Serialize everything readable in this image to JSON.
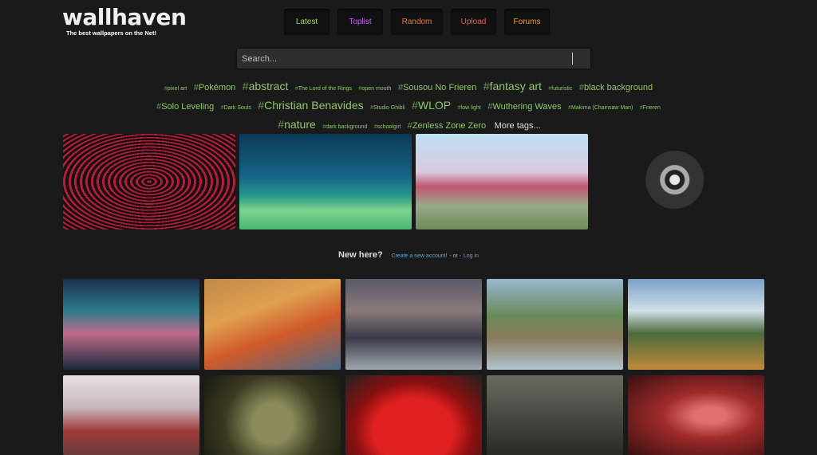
{
  "logo": {
    "title": "wallhaven",
    "tagline": "The best wallpapers on the Net!"
  },
  "nav": [
    {
      "label": "Latest",
      "color": "#a3d95f"
    },
    {
      "label": "Toplist",
      "color": "#c25ef5"
    },
    {
      "label": "Random",
      "color": "#e07b3c"
    },
    {
      "label": "Upload",
      "color": "#ef5a4c"
    },
    {
      "label": "Forums",
      "color": "#ee9a2d"
    }
  ],
  "search": {
    "placeholder": "Search..."
  },
  "tags": [
    "pixel art",
    "Pokémon",
    "abstract",
    "The Lord of the Rings",
    "open mouth",
    "Sousou No Frieren",
    "fantasy art",
    "futuristic",
    "black background",
    "Solo Leveling",
    "Dark Souls",
    "Christian Benavides",
    "Studio Ghibli",
    "WLOP",
    "low light",
    "Wuthering Waves",
    "Makima (Chainsaw Man)",
    "Frieren",
    "nature",
    "dark background",
    "schoolgirl",
    "Zenless Zone Zero"
  ],
  "more_tags": "More tags...",
  "new_here": {
    "question": "New here?",
    "create": "Create a new account!",
    "or": "- or -",
    "login": "Log in"
  }
}
